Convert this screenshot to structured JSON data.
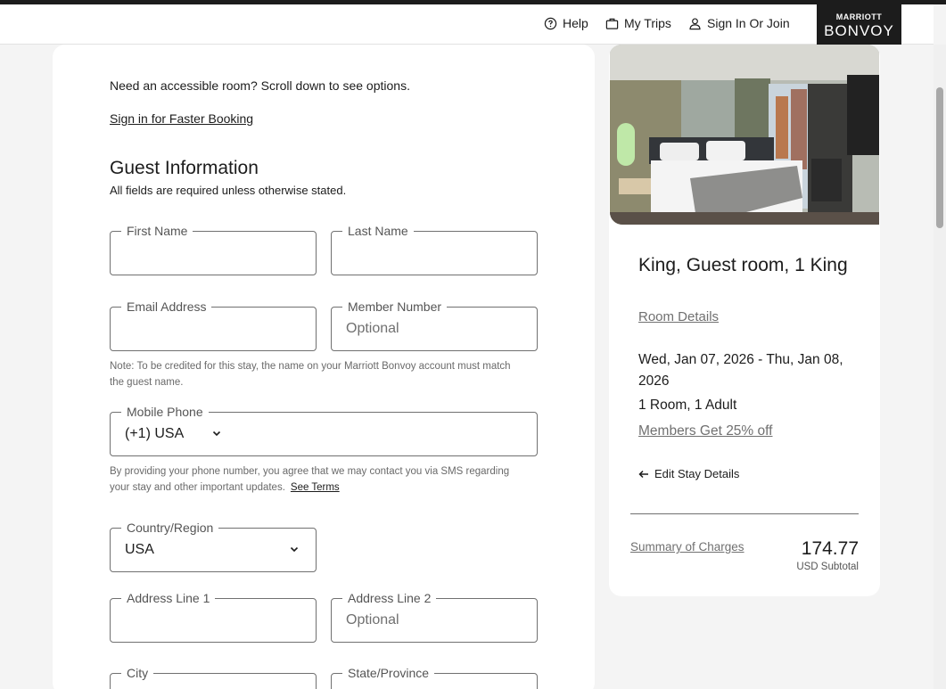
{
  "header": {
    "help_label": "Help",
    "trips_label": "My Trips",
    "signin_label": "Sign In Or Join",
    "logo_line1": "MARRIOTT",
    "logo_line2": "BONVOY"
  },
  "form": {
    "accessible_note": "Need an accessible room? Scroll down to see options.",
    "signin_link": "Sign in for Faster Booking",
    "section_title": "Guest Information",
    "section_subtitle": "All fields are required unless otherwise stated.",
    "first_name_label": "First Name",
    "last_name_label": "Last Name",
    "email_label": "Email Address",
    "member_label": "Member Number",
    "member_placeholder": "Optional",
    "name_note_line1": "Note: To be credited for this stay, the name on your Marriott Bonvoy account must match",
    "name_note_line2": "the guest name.",
    "phone_label": "Mobile Phone",
    "phone_value": "(+1) USA",
    "sms_note_line1": "By providing your phone number, you agree that we may contact you via SMS regarding",
    "sms_note_line2": "your stay and other important updates.",
    "see_terms": "See Terms",
    "country_label": "Country/Region",
    "country_value": "USA",
    "address1_label": "Address Line 1",
    "address2_label": "Address Line 2",
    "address2_placeholder": "Optional",
    "city_label": "City",
    "state_label": "State/Province"
  },
  "summary": {
    "room_title": "King, Guest room, 1 King",
    "room_details": "Room Details",
    "dates": "Wed, Jan 07, 2026 - Thu, Jan 08, 2026",
    "rooms_guests": "1 Room, 1 Adult",
    "members_offer": "Members Get 25% off",
    "edit_stay": "Edit Stay Details",
    "charges_link": "Summary of Charges",
    "price": "174.77",
    "price_sub": "USD Subtotal"
  }
}
